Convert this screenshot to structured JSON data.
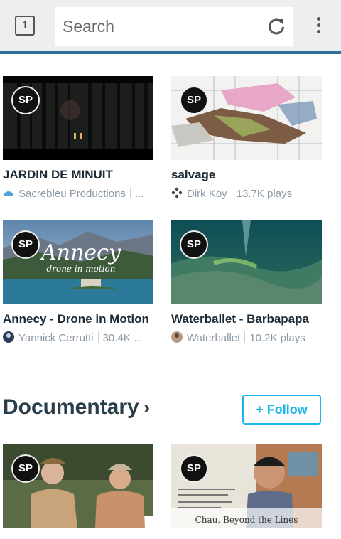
{
  "toolbar": {
    "tab_count": "1",
    "search_placeholder": "Search"
  },
  "videos": [
    {
      "title": "JARDIN DE MINUIT",
      "author": "Sacrebleu Productions",
      "plays": "..."
    },
    {
      "title": "salvage",
      "author": "Dirk Koy",
      "plays": "13.7K plays"
    },
    {
      "title": "Annecy - Drone in Motion",
      "author": "Yannick Cerrutti",
      "plays": "30.4K ...",
      "overlay_title": "Annecy",
      "overlay_subtitle": "drone in motion"
    },
    {
      "title": "Waterballet - Barbapapa",
      "author": "Waterballet",
      "plays": "10.2K plays"
    }
  ],
  "badge_text": "SP",
  "section": {
    "title": "Documentary",
    "follow_label": "+ Follow"
  },
  "documentary": [
    {
      "caption": ""
    },
    {
      "caption": "Chau, Beyond the Lines"
    }
  ],
  "colors": {
    "accent": "#1ab7ea",
    "toolbar_underline": "#2f6e99",
    "title_text": "#1a2a36",
    "meta_text": "#8b98a3"
  }
}
